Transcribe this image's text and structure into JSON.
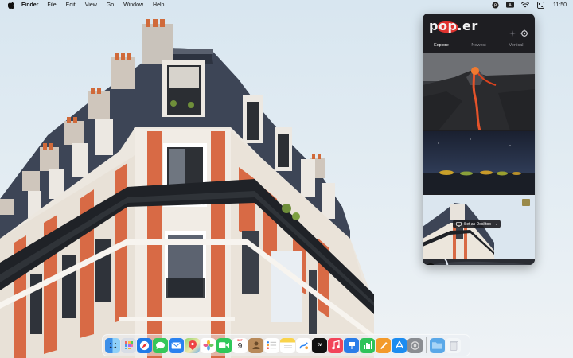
{
  "menubar": {
    "app_name": "Finder",
    "menus": [
      "File",
      "Edit",
      "View",
      "Go",
      "Window",
      "Help"
    ],
    "clock": "11:50",
    "icons": [
      "poppler-status-icon",
      "text-input-icon",
      "wifi-icon",
      "control-center-icon"
    ],
    "input_label": "A"
  },
  "popover": {
    "logo_text": "pop.er",
    "tabs": [
      {
        "label": "Explore",
        "active": true
      },
      {
        "label": "Newest",
        "active": false
      },
      {
        "label": "Vertical",
        "active": false
      }
    ],
    "set_desktop_label": "Set as Desktop"
  },
  "dock": {
    "apps": [
      "Finder",
      "Launchpad",
      "Safari",
      "Messages",
      "Mail",
      "Maps",
      "Photos",
      "FaceTime",
      "Calendar",
      "Contacts",
      "Reminders",
      "Notes",
      "Freeform",
      "TV",
      "Music",
      "Keynote",
      "Numbers",
      "Pages",
      "App Store",
      "System Settings",
      "Downloads",
      "Trash"
    ],
    "calendar_month": "SEP",
    "calendar_day": "9"
  },
  "colors": {
    "accent": "#e0332f",
    "popover_bg": "#1e1e22"
  }
}
